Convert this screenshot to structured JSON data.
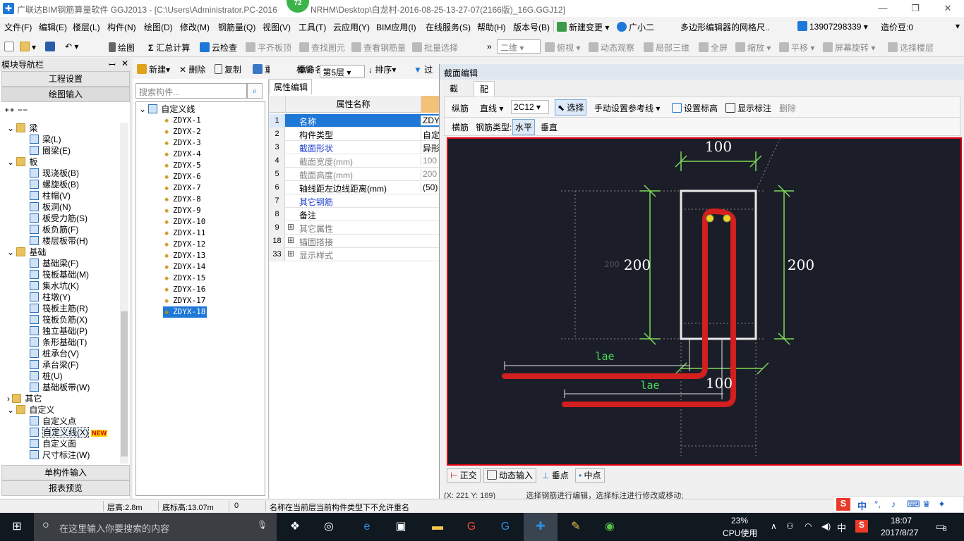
{
  "window": {
    "title": "广联达BIM钢筋算量软件 GGJ2013 - [C:\\Users\\Administrator.PC-2016",
    "title_tail": "NRHM\\Desktop\\白龙村-2016-08-25-13-27-07(2166版)_16G.GGJ12]",
    "badge": "72"
  },
  "menu": {
    "items": [
      "文件(F)",
      "编辑(E)",
      "楼层(L)",
      "构件(N)",
      "绘图(D)",
      "修改(M)",
      "钢筋量(Q)",
      "视图(V)",
      "工具(T)",
      "云应用(Y)",
      "BIM应用(I)",
      "在线服务(S)",
      "帮助(H)",
      "版本号(B)"
    ],
    "new_change": "新建变更",
    "assistant": "广小二",
    "notice": "多边形编辑器的网格尺..",
    "phone": "13907298339",
    "bean": "造价豆:0"
  },
  "toolbar": {
    "draw": "绘图",
    "sum": "汇总计算",
    "cloud_check": "云检查",
    "flat_slab": "平齐板顶",
    "find_element": "查找图元",
    "view_rebar": "查看钢筋量",
    "batch_select": "批量选择",
    "view_mode": "二维",
    "top_view": "俯视",
    "dynamic_view": "动态观察",
    "local_3d": "局部三维",
    "fullscreen": "全屏",
    "zoom": "缩放",
    "pan": "平移",
    "rotate": "屏幕旋转",
    "select_floor": "选择楼层"
  },
  "nav": {
    "title": "模块导航栏",
    "project_settings": "工程设置",
    "drawing_input": "绘图输入",
    "single_input": "单构件输入",
    "report_preview": "报表预览",
    "tree": [
      {
        "label": "梁",
        "level": 0,
        "folder": true
      },
      {
        "label": "梁(L)",
        "level": 1
      },
      {
        "label": "圈梁(E)",
        "level": 1
      },
      {
        "label": "板",
        "level": 0,
        "folder": true
      },
      {
        "label": "现浇板(B)",
        "level": 1
      },
      {
        "label": "螺旋板(B)",
        "level": 1
      },
      {
        "label": "柱帽(V)",
        "level": 1
      },
      {
        "label": "板洞(N)",
        "level": 1
      },
      {
        "label": "板受力筋(S)",
        "level": 1
      },
      {
        "label": "板负筋(F)",
        "level": 1
      },
      {
        "label": "楼层板带(H)",
        "level": 1
      },
      {
        "label": "基础",
        "level": 0,
        "folder": true
      },
      {
        "label": "基础梁(F)",
        "level": 1
      },
      {
        "label": "筏板基础(M)",
        "level": 1
      },
      {
        "label": "集水坑(K)",
        "level": 1
      },
      {
        "label": "柱墩(Y)",
        "level": 1
      },
      {
        "label": "筏板主筋(R)",
        "level": 1
      },
      {
        "label": "筏板负筋(X)",
        "level": 1
      },
      {
        "label": "独立基础(P)",
        "level": 1
      },
      {
        "label": "条形基础(T)",
        "level": 1
      },
      {
        "label": "桩承台(V)",
        "level": 1
      },
      {
        "label": "承台梁(F)",
        "level": 1
      },
      {
        "label": "桩(U)",
        "level": 1
      },
      {
        "label": "基础板带(W)",
        "level": 1
      },
      {
        "label": "其它",
        "level": 0,
        "folder": true,
        "collapsed": true
      },
      {
        "label": "自定义",
        "level": 0,
        "folder": true
      },
      {
        "label": "自定义点",
        "level": 1
      },
      {
        "label": "自定义线(X)",
        "level": 1,
        "selected": true
      },
      {
        "label": "自定义面",
        "level": 1
      },
      {
        "label": "尺寸标注(W)",
        "level": 1
      }
    ],
    "new_badge": "NEW"
  },
  "components": {
    "new": "新建",
    "delete": "删除",
    "copy": "复制",
    "rename": "重命名",
    "floor_label": "楼层",
    "floor_value": "第5层",
    "sort": "排序",
    "filter": "过",
    "search_placeholder": "搜索构件...",
    "root": "自定义线",
    "items": [
      "ZDYX-1",
      "ZDYX-2",
      "ZDYX-3",
      "ZDYX-4",
      "ZDYX-5",
      "ZDYX-6",
      "ZDYX-7",
      "ZDYX-8",
      "ZDYX-9",
      "ZDYX-10",
      "ZDYX-11",
      "ZDYX-12",
      "ZDYX-13",
      "ZDYX-14",
      "ZDYX-15",
      "ZDYX-16",
      "ZDYX-17",
      "ZDYX-18"
    ],
    "selected_index": 17
  },
  "properties": {
    "tab": "属性编辑",
    "header": "属性名称",
    "rows": [
      {
        "no": "1",
        "name": "名称",
        "value": "ZDYX-",
        "style": "selected"
      },
      {
        "no": "2",
        "name": "构件类型",
        "value": "自定",
        "style": "normal"
      },
      {
        "no": "3",
        "name": "截面形状",
        "value": "异形",
        "style": "blue"
      },
      {
        "no": "4",
        "name": "截面宽度(mm)",
        "value": "100",
        "style": "gray"
      },
      {
        "no": "5",
        "name": "截面高度(mm)",
        "value": "200",
        "style": "gray"
      },
      {
        "no": "6",
        "name": "轴线距左边线距离(mm)",
        "value": "(50)",
        "style": "normal"
      },
      {
        "no": "7",
        "name": "其它钢筋",
        "value": "",
        "style": "blue"
      },
      {
        "no": "8",
        "name": "备注",
        "value": "",
        "style": "normal"
      },
      {
        "no": "9",
        "name": "其它属性",
        "value": "",
        "style": "group"
      },
      {
        "no": "18",
        "name": "锚固搭接",
        "value": "",
        "style": "group"
      },
      {
        "no": "33",
        "name": "显示样式",
        "value": "",
        "style": "group"
      }
    ]
  },
  "editor": {
    "title": "截面编辑",
    "tabs": [
      "截面",
      "配筋"
    ],
    "active_tab": "配筋",
    "longitudinal": "纵筋",
    "line_type": "直线",
    "rebar_spec": "2C12",
    "select": "选择",
    "manual_ref": "手动设置参考线",
    "set_elevation": "设置标高",
    "show_label": "显示标注",
    "delete": "删除",
    "transverse": "横筋",
    "rebar_type_label": "钢筋类型:",
    "horizontal": "水平",
    "vertical": "垂直",
    "dims": {
      "top": "100",
      "left": "200",
      "right": "200",
      "bottom": "100",
      "small": "200",
      "lae1": "lae",
      "lae2": "lae"
    },
    "footer": {
      "ortho": "正交",
      "dynamic_input": "动态输入",
      "perpendicular": "垂点",
      "midpoint": "中点"
    },
    "coord": "(X: 221 Y: 169)",
    "hint": "选择钢筋进行编辑，选择标注进行修改或移动;"
  },
  "status": {
    "floor_height": "层高:2.8m",
    "base_elev": "底标高:13.07m",
    "zero": "0",
    "message": "名称在当前层当前构件类型下不允许重名"
  },
  "taskbar": {
    "search": "在这里输入你要搜索的内容",
    "cpu_pct": "23%",
    "cpu_label": "CPU使用",
    "ime": "中",
    "time": "18:07",
    "date": "2017/8/27",
    "notif": "8"
  },
  "colors": {
    "accent": "#1e78d7",
    "rebar": "#d21f1f",
    "dim": "#7ed957",
    "canvas": "#1b1e28",
    "frame": "#e0000f"
  }
}
